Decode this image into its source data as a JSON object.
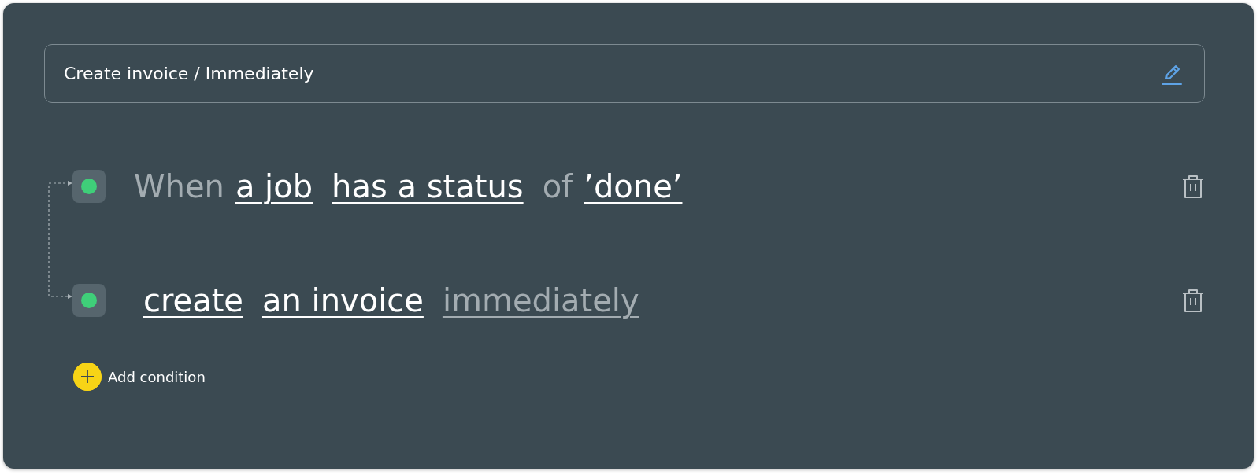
{
  "header": {
    "title": "Create invoice / Immediately"
  },
  "rules": [
    {
      "words": [
        {
          "kind": "plain",
          "text": "When"
        },
        {
          "kind": "token",
          "text": "a job"
        },
        {
          "kind": "token",
          "text": "has a status"
        },
        {
          "kind": "plain",
          "text": "of"
        },
        {
          "kind": "token",
          "text": "’done’"
        }
      ]
    },
    {
      "words": [
        {
          "kind": "token",
          "text": "create"
        },
        {
          "kind": "token",
          "text": "an invoice"
        },
        {
          "kind": "muted-token",
          "text": "immediately"
        }
      ]
    }
  ],
  "add_button": {
    "label": "Add condition"
  }
}
